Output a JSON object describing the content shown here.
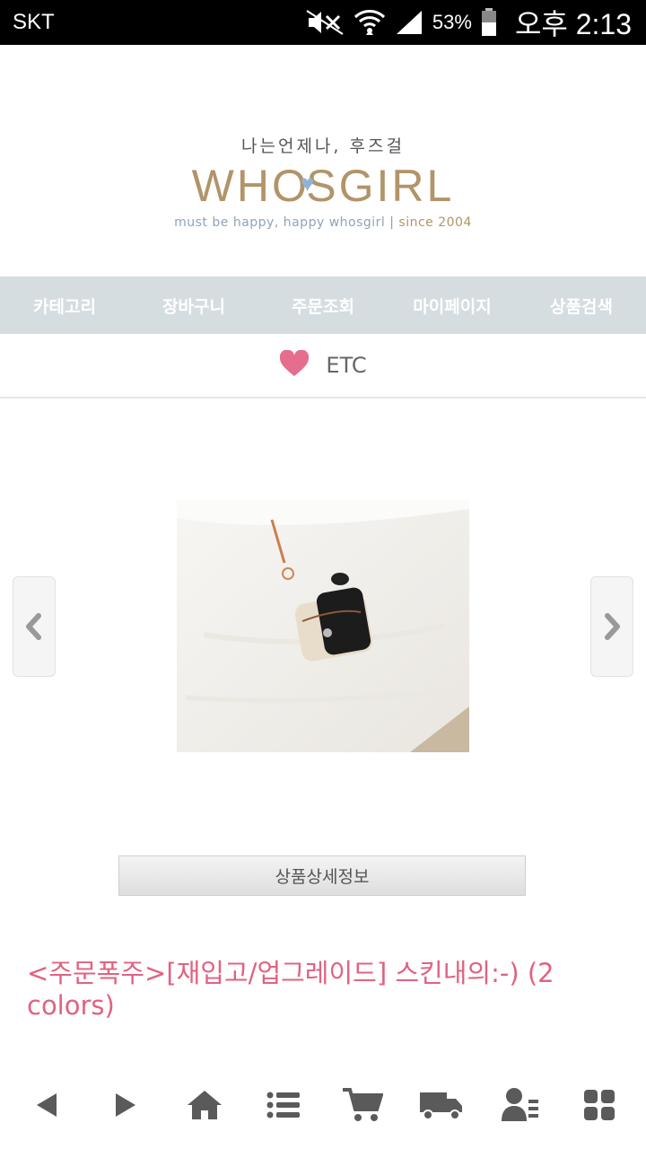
{
  "status_bar": {
    "carrier": "SKT",
    "battery": "53%",
    "time": "오후 2:13"
  },
  "logo": {
    "tagline_ko": "나는언제나, 후즈걸",
    "brand_left": "WH",
    "brand_right": "SGIRL",
    "subtitle": "must be happy, happy whosgirl",
    "since": "| since 2004"
  },
  "nav": {
    "items": [
      {
        "label": "카테고리"
      },
      {
        "label": "장바구니"
      },
      {
        "label": "주문조회"
      },
      {
        "label": "마이페이지"
      },
      {
        "label": "상품검색"
      }
    ]
  },
  "category": {
    "label": "ETC",
    "icon": "heart-icon"
  },
  "product": {
    "detail_button": "상품상세정보",
    "title": "<주문폭주>[재입고/업그레이드] 스킨내의:-) (2 colors)"
  },
  "bottom_bar": {
    "icons": [
      "back-icon",
      "forward-icon",
      "home-icon",
      "list-icon",
      "cart-icon",
      "delivery-icon",
      "user-icon",
      "grid-icon"
    ]
  },
  "colors": {
    "nav_bg": "#d5dde0",
    "brand": "#b19468",
    "accent_pink": "#e0637f",
    "heart": "#e56d8d"
  }
}
